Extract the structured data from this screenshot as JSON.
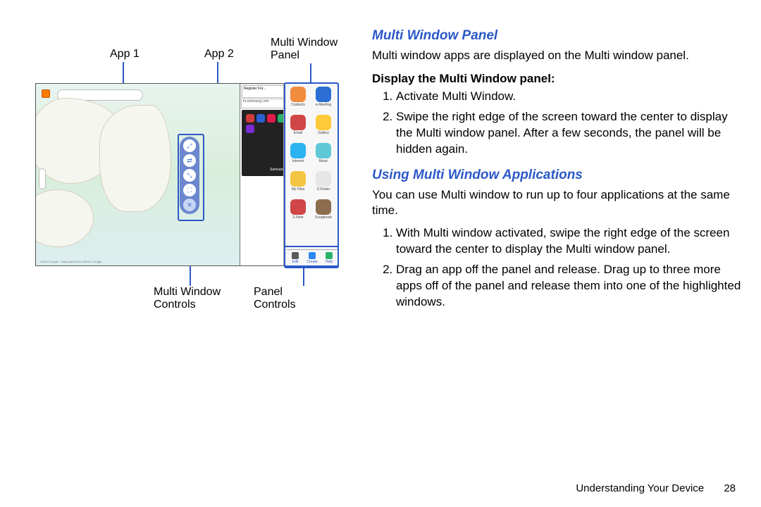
{
  "callouts": {
    "app1": "App 1",
    "app2": "App 2",
    "mw_panel_l1": "Multi Window",
    "mw_panel_l2": "Panel",
    "mw_controls_l1": "Multi Window",
    "mw_controls_l2": "Controls",
    "panel_controls_l1": "Panel",
    "panel_controls_l2": "Controls"
  },
  "figure": {
    "browser_tab": "Register For...",
    "browser_url": "m.samsung.com",
    "promo_text": "Samsung Ownership Has",
    "map_credit": "©2014 Google – Map data ©2014 INEGI, Google",
    "apps": [
      {
        "name": "Contacts",
        "color": "#f28c3e"
      },
      {
        "name": "e-Meeting",
        "color": "#2b6fd4"
      },
      {
        "name": "Email",
        "color": "#d14646"
      },
      {
        "name": "Gallery",
        "color": "#ffca3a"
      },
      {
        "name": "Internet",
        "color": "#2bb3f0"
      },
      {
        "name": "Music",
        "color": "#5fc8d6"
      },
      {
        "name": "My Files",
        "color": "#f4c542"
      },
      {
        "name": "S Finder",
        "color": "#e6e6e6"
      },
      {
        "name": "S Note",
        "color": "#d14646"
      },
      {
        "name": "Scrapbook",
        "color": "#8c6e4e"
      }
    ],
    "panel_controls": [
      {
        "name": "Edit",
        "color": "#5a5a5a"
      },
      {
        "name": "Create",
        "color": "#2b88f0"
      },
      {
        "name": "Help",
        "color": "#2bb36a"
      }
    ],
    "promo_colors": [
      "#d13b3b",
      "#2b60d1",
      "#e01b4c",
      "#27b36a",
      "#3b3b3b",
      "#d18c2b",
      "#1fa5a5",
      "#d14bb0",
      "#7a2bd1"
    ]
  },
  "right": {
    "h_panel": "Multi Window Panel",
    "panel_intro": "Multi window apps are displayed on the Multi window panel.",
    "display_sub": "Display the Multi Window panel:",
    "display_steps": [
      "Activate Multi Window.",
      "Swipe the right edge of the screen toward the center to display the Multi window panel. After a few seconds, the panel will be hidden again."
    ],
    "h_using": "Using Multi Window Applications",
    "using_intro": "You can use Multi window to run up to four applications at the same time.",
    "using_steps": [
      "With Multi window activated, swipe the right edge of the screen toward the center to display the Multi window panel.",
      "Drag an app off the panel and release. Drag up to three more apps off of the panel and release them into one of the highlighted windows."
    ]
  },
  "footer": {
    "section": "Understanding Your Device",
    "page": "28"
  }
}
